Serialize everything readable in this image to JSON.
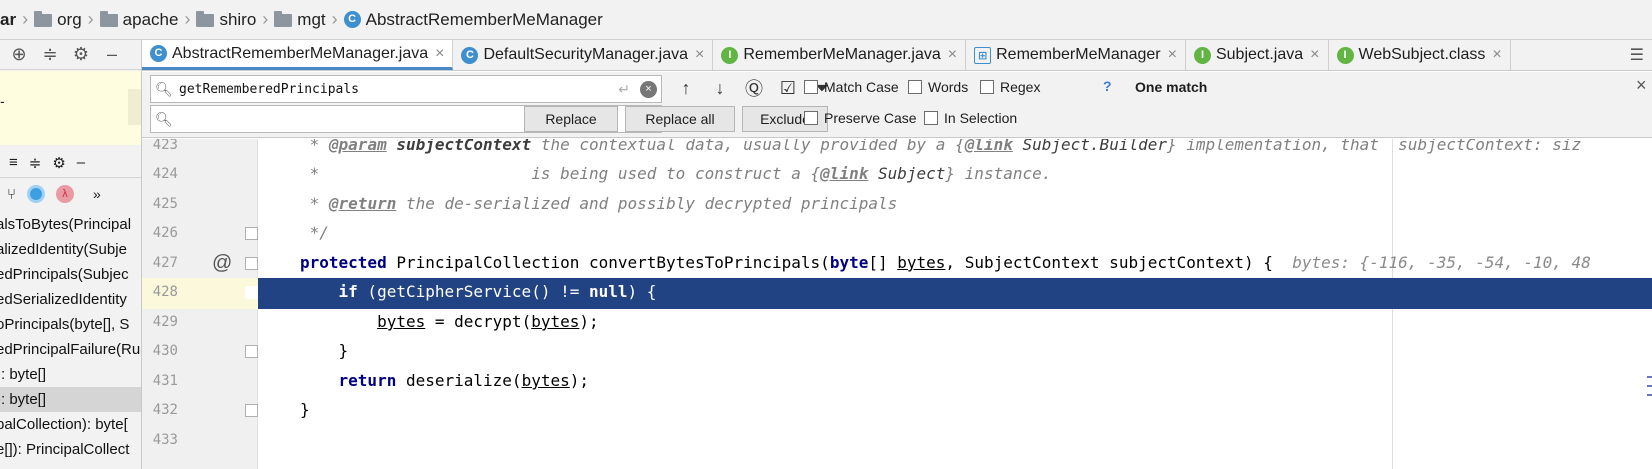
{
  "breadcrumb": [
    "ar",
    "org",
    "apache",
    "shiro",
    "mgt",
    "AbstractRememberMeManager"
  ],
  "tabs": [
    {
      "label": "AbstractRememberMeManager.java",
      "icon": "class-icon",
      "active": true
    },
    {
      "label": "DefaultSecurityManager.java",
      "icon": "class-icon"
    },
    {
      "label": "RememberMeManager.java",
      "icon": "interface-icon"
    },
    {
      "label": "RememberMeManager",
      "icon": "hierarchy-icon"
    },
    {
      "label": "Subject.java",
      "icon": "interface-icon"
    },
    {
      "label": "WebSubject.class",
      "icon": "interface-icon"
    }
  ],
  "find": {
    "search_value": "getRememberedPrincipals",
    "replace_value": "",
    "options": [
      {
        "label": "Match Case",
        "checked": false
      },
      {
        "label": "Words",
        "checked": false
      },
      {
        "label": "Regex",
        "checked": false
      },
      {
        "label": "Preserve Case",
        "checked": false
      },
      {
        "label": "In Selection",
        "checked": false
      }
    ],
    "help": "?",
    "result": "One match",
    "buttons": [
      "Replace",
      "Replace all",
      "Exclude"
    ]
  },
  "structure_items": [
    "alsToBytes(Principal",
    "alizedIdentity(Subje",
    "edPrincipals(Subjec",
    "edSerializedIdentity",
    "oPrincipals(byte[], S",
    "edPrincipalFailure(Ru",
    "): byte[]",
    "): byte[]",
    "palCollection): byte[",
    "e[]): PrincipalCollect"
  ],
  "code": {
    "line_numbers": [
      "423",
      "424",
      "425",
      "426",
      "427",
      "428",
      "429",
      "430",
      "431",
      "432",
      "433"
    ],
    "l423": {
      "star": " * ",
      "tag": "@param",
      "name": " subjectContext",
      "text": " the contextual data, usually provided by a {",
      "link": "@link",
      "ref": " Subject.Builder",
      "tail": "} implementation, that  subjectContext: siz"
    },
    "l424": {
      "star": " *                      is being used to construct a {",
      "link": "@link",
      "ref": " Subject",
      "tail": "} instance."
    },
    "l425": {
      "star": " * ",
      "tag": "@return",
      "text": " the de-serialized and possibly decrypted principals"
    },
    "l426": " */",
    "l427": {
      "kw": "protected",
      "t1": " PrincipalCollection convertBytesToPrincipals(",
      "kw2": "byte",
      "t2": "[] ",
      "v1": "bytes",
      "t3": ", SubjectContext subjectContext) {  ",
      "hint": "bytes: {-116, -35, -54, -10, 48"
    },
    "l428": {
      "kw": "if",
      "t1": " (getCipherService() != ",
      "kw2": "null",
      "t2": ") {"
    },
    "l429": {
      "v1": "bytes",
      "t1": " = decrypt(",
      "v2": "bytes",
      "t2": ");"
    },
    "l430": "}",
    "l431": {
      "kw": "return",
      "t1": " deserialize(",
      "v1": "bytes",
      "t2": ");"
    },
    "l432": "}"
  }
}
